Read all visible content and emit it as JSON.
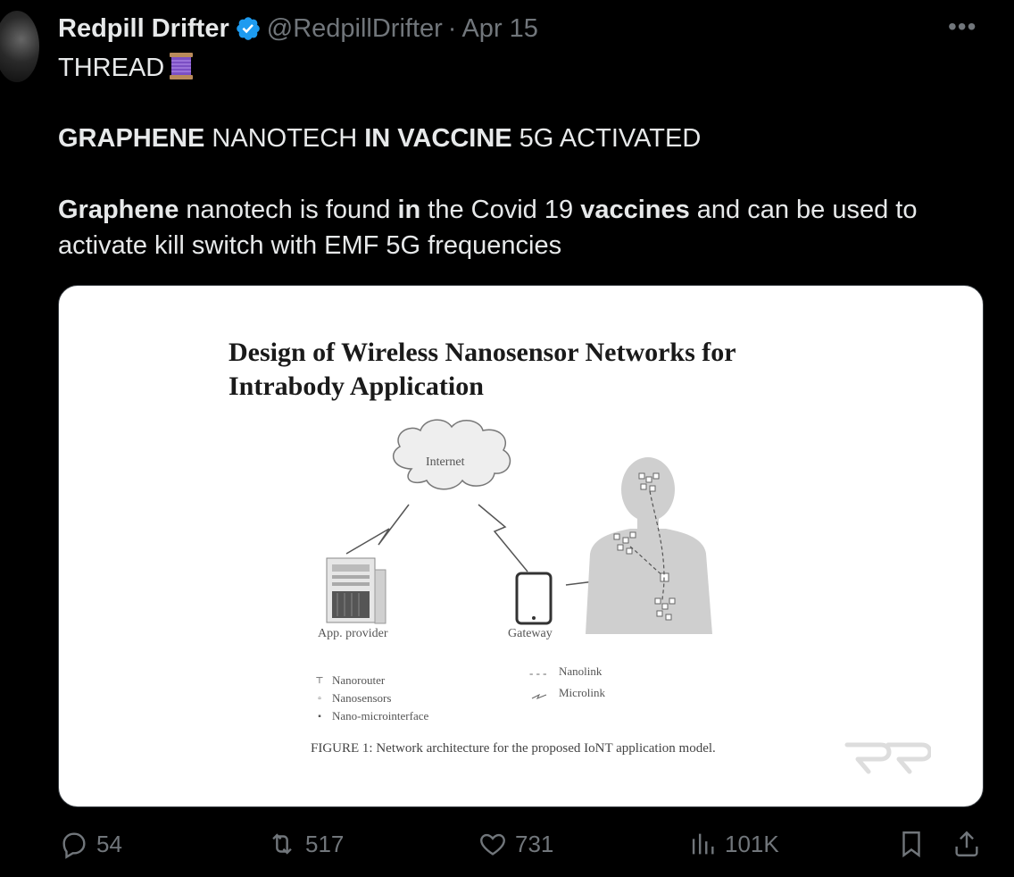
{
  "post": {
    "author_name": "Redpill Drifter",
    "author_handle": "@RedpillDrifter",
    "separator": "·",
    "date": "Apr 15",
    "more_label": "•••",
    "thread_label": "THREAD",
    "line2_parts": [
      "GRAPHENE",
      " NANOTECH ",
      "IN VACCINE",
      " 5G ACTIVATED"
    ],
    "line3_parts": [
      "Graphene",
      " nanotech is found ",
      "in",
      " the Covid 19 ",
      "vaccines",
      " and can be used to"
    ],
    "line4": "activate kill switch with EMF 5G frequencies"
  },
  "media": {
    "paper_title_line1": "Design of Wireless Nanosensor Networks for",
    "paper_title_line2": "Intrabody Application",
    "diagram": {
      "internet_label": "Internet",
      "app_provider_label": "App. provider",
      "gateway_label": "Gateway"
    },
    "legend_left": [
      "Nanorouter",
      "Nanosensors",
      "Nano-microinterface"
    ],
    "legend_right": [
      "Nanolink",
      "Microlink"
    ],
    "caption": "FIGURE 1: Network architecture for the proposed IoNT application model."
  },
  "actions": {
    "replies": "54",
    "reposts": "517",
    "likes": "731",
    "views": "101K"
  },
  "colors": {
    "background": "#000000",
    "text": "#e7e9ea",
    "muted": "#71767b",
    "verified": "#1d9bf0"
  }
}
